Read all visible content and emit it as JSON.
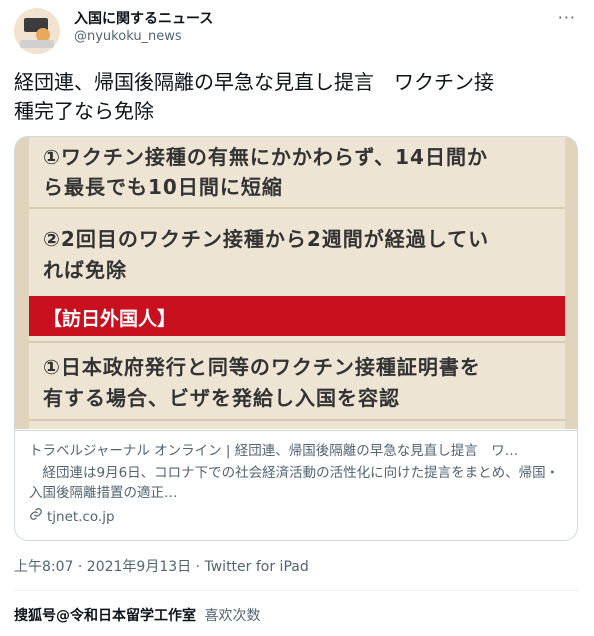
{
  "account": {
    "name": "入国に関するニュース",
    "handle": "@nyukoku_news"
  },
  "tweet": {
    "line1": "経団連、帰国後隔離の早急な見直し提言　ワクチン接",
    "line2": "種完了なら免除"
  },
  "card_image": {
    "item1_line1": "①ワクチン接種の有無にかかわらず、14日間か",
    "item1_line2": "ら最長でも10日間に短縮",
    "item2_line1": "②2回目のワクチン接種から2週間が経過してい",
    "item2_line2": "れば免除",
    "section_label": "【訪日外国人】",
    "item3_line1": "①日本政府発行と同等のワクチン接種証明書を",
    "item3_line2": "有する場合、ビザを発給し入国を容認"
  },
  "card": {
    "title": "トラベルジャーナル オンライン | 経団連、帰国後隔離の早急な見直し提言　ワ…",
    "description": "　経団連は9月6日、コロナ下での社会経済活動の活性化に向けた提言をまとめ、帰国・入国後隔離措置の適正…",
    "domain": "tjnet.co.jp"
  },
  "meta": {
    "timestamp": "上午8:07 · 2021年9月13日 · Twitter for iPad",
    "watermark": "搜狐号@令和日本留学工作室",
    "likes_label": "喜欢次数"
  },
  "colors": {
    "band_red": "#c8101f",
    "card_bg": "#ede4d4",
    "muted_text": "#536471"
  },
  "icons": [
    "more-icon",
    "link-icon",
    "avatar"
  ]
}
